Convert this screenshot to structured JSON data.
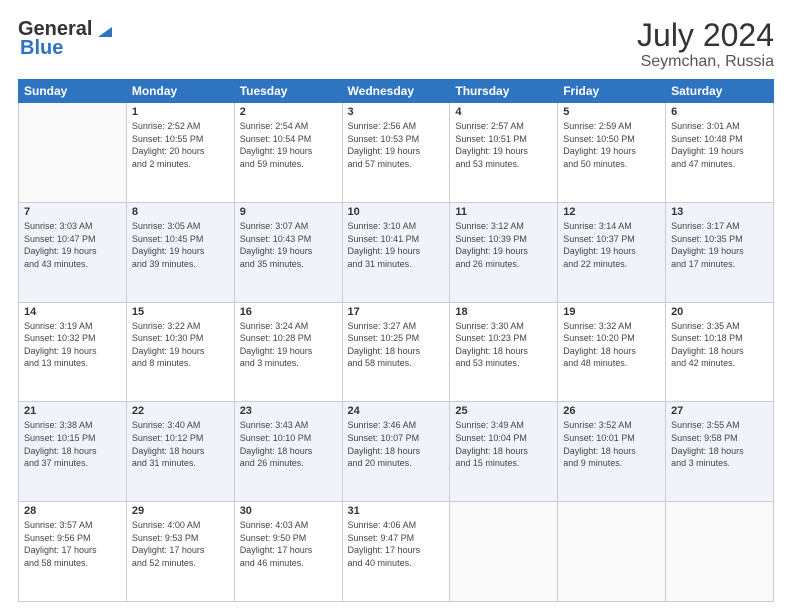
{
  "header": {
    "logo_line1": "General",
    "logo_line2": "Blue",
    "title": "July 2024",
    "subtitle": "Seymchan, Russia"
  },
  "days_of_week": [
    "Sunday",
    "Monday",
    "Tuesday",
    "Wednesday",
    "Thursday",
    "Friday",
    "Saturday"
  ],
  "weeks": [
    [
      {
        "day": "",
        "info": ""
      },
      {
        "day": "1",
        "info": "Sunrise: 2:52 AM\nSunset: 10:55 PM\nDaylight: 20 hours\nand 2 minutes."
      },
      {
        "day": "2",
        "info": "Sunrise: 2:54 AM\nSunset: 10:54 PM\nDaylight: 19 hours\nand 59 minutes."
      },
      {
        "day": "3",
        "info": "Sunrise: 2:56 AM\nSunset: 10:53 PM\nDaylight: 19 hours\nand 57 minutes."
      },
      {
        "day": "4",
        "info": "Sunrise: 2:57 AM\nSunset: 10:51 PM\nDaylight: 19 hours\nand 53 minutes."
      },
      {
        "day": "5",
        "info": "Sunrise: 2:59 AM\nSunset: 10:50 PM\nDaylight: 19 hours\nand 50 minutes."
      },
      {
        "day": "6",
        "info": "Sunrise: 3:01 AM\nSunset: 10:48 PM\nDaylight: 19 hours\nand 47 minutes."
      }
    ],
    [
      {
        "day": "7",
        "info": "Sunrise: 3:03 AM\nSunset: 10:47 PM\nDaylight: 19 hours\nand 43 minutes."
      },
      {
        "day": "8",
        "info": "Sunrise: 3:05 AM\nSunset: 10:45 PM\nDaylight: 19 hours\nand 39 minutes."
      },
      {
        "day": "9",
        "info": "Sunrise: 3:07 AM\nSunset: 10:43 PM\nDaylight: 19 hours\nand 35 minutes."
      },
      {
        "day": "10",
        "info": "Sunrise: 3:10 AM\nSunset: 10:41 PM\nDaylight: 19 hours\nand 31 minutes."
      },
      {
        "day": "11",
        "info": "Sunrise: 3:12 AM\nSunset: 10:39 PM\nDaylight: 19 hours\nand 26 minutes."
      },
      {
        "day": "12",
        "info": "Sunrise: 3:14 AM\nSunset: 10:37 PM\nDaylight: 19 hours\nand 22 minutes."
      },
      {
        "day": "13",
        "info": "Sunrise: 3:17 AM\nSunset: 10:35 PM\nDaylight: 19 hours\nand 17 minutes."
      }
    ],
    [
      {
        "day": "14",
        "info": "Sunrise: 3:19 AM\nSunset: 10:32 PM\nDaylight: 19 hours\nand 13 minutes."
      },
      {
        "day": "15",
        "info": "Sunrise: 3:22 AM\nSunset: 10:30 PM\nDaylight: 19 hours\nand 8 minutes."
      },
      {
        "day": "16",
        "info": "Sunrise: 3:24 AM\nSunset: 10:28 PM\nDaylight: 19 hours\nand 3 minutes."
      },
      {
        "day": "17",
        "info": "Sunrise: 3:27 AM\nSunset: 10:25 PM\nDaylight: 18 hours\nand 58 minutes."
      },
      {
        "day": "18",
        "info": "Sunrise: 3:30 AM\nSunset: 10:23 PM\nDaylight: 18 hours\nand 53 minutes."
      },
      {
        "day": "19",
        "info": "Sunrise: 3:32 AM\nSunset: 10:20 PM\nDaylight: 18 hours\nand 48 minutes."
      },
      {
        "day": "20",
        "info": "Sunrise: 3:35 AM\nSunset: 10:18 PM\nDaylight: 18 hours\nand 42 minutes."
      }
    ],
    [
      {
        "day": "21",
        "info": "Sunrise: 3:38 AM\nSunset: 10:15 PM\nDaylight: 18 hours\nand 37 minutes."
      },
      {
        "day": "22",
        "info": "Sunrise: 3:40 AM\nSunset: 10:12 PM\nDaylight: 18 hours\nand 31 minutes."
      },
      {
        "day": "23",
        "info": "Sunrise: 3:43 AM\nSunset: 10:10 PM\nDaylight: 18 hours\nand 26 minutes."
      },
      {
        "day": "24",
        "info": "Sunrise: 3:46 AM\nSunset: 10:07 PM\nDaylight: 18 hours\nand 20 minutes."
      },
      {
        "day": "25",
        "info": "Sunrise: 3:49 AM\nSunset: 10:04 PM\nDaylight: 18 hours\nand 15 minutes."
      },
      {
        "day": "26",
        "info": "Sunrise: 3:52 AM\nSunset: 10:01 PM\nDaylight: 18 hours\nand 9 minutes."
      },
      {
        "day": "27",
        "info": "Sunrise: 3:55 AM\nSunset: 9:58 PM\nDaylight: 18 hours\nand 3 minutes."
      }
    ],
    [
      {
        "day": "28",
        "info": "Sunrise: 3:57 AM\nSunset: 9:56 PM\nDaylight: 17 hours\nand 58 minutes."
      },
      {
        "day": "29",
        "info": "Sunrise: 4:00 AM\nSunset: 9:53 PM\nDaylight: 17 hours\nand 52 minutes."
      },
      {
        "day": "30",
        "info": "Sunrise: 4:03 AM\nSunset: 9:50 PM\nDaylight: 17 hours\nand 46 minutes."
      },
      {
        "day": "31",
        "info": "Sunrise: 4:06 AM\nSunset: 9:47 PM\nDaylight: 17 hours\nand 40 minutes."
      },
      {
        "day": "",
        "info": ""
      },
      {
        "day": "",
        "info": ""
      },
      {
        "day": "",
        "info": ""
      }
    ]
  ]
}
